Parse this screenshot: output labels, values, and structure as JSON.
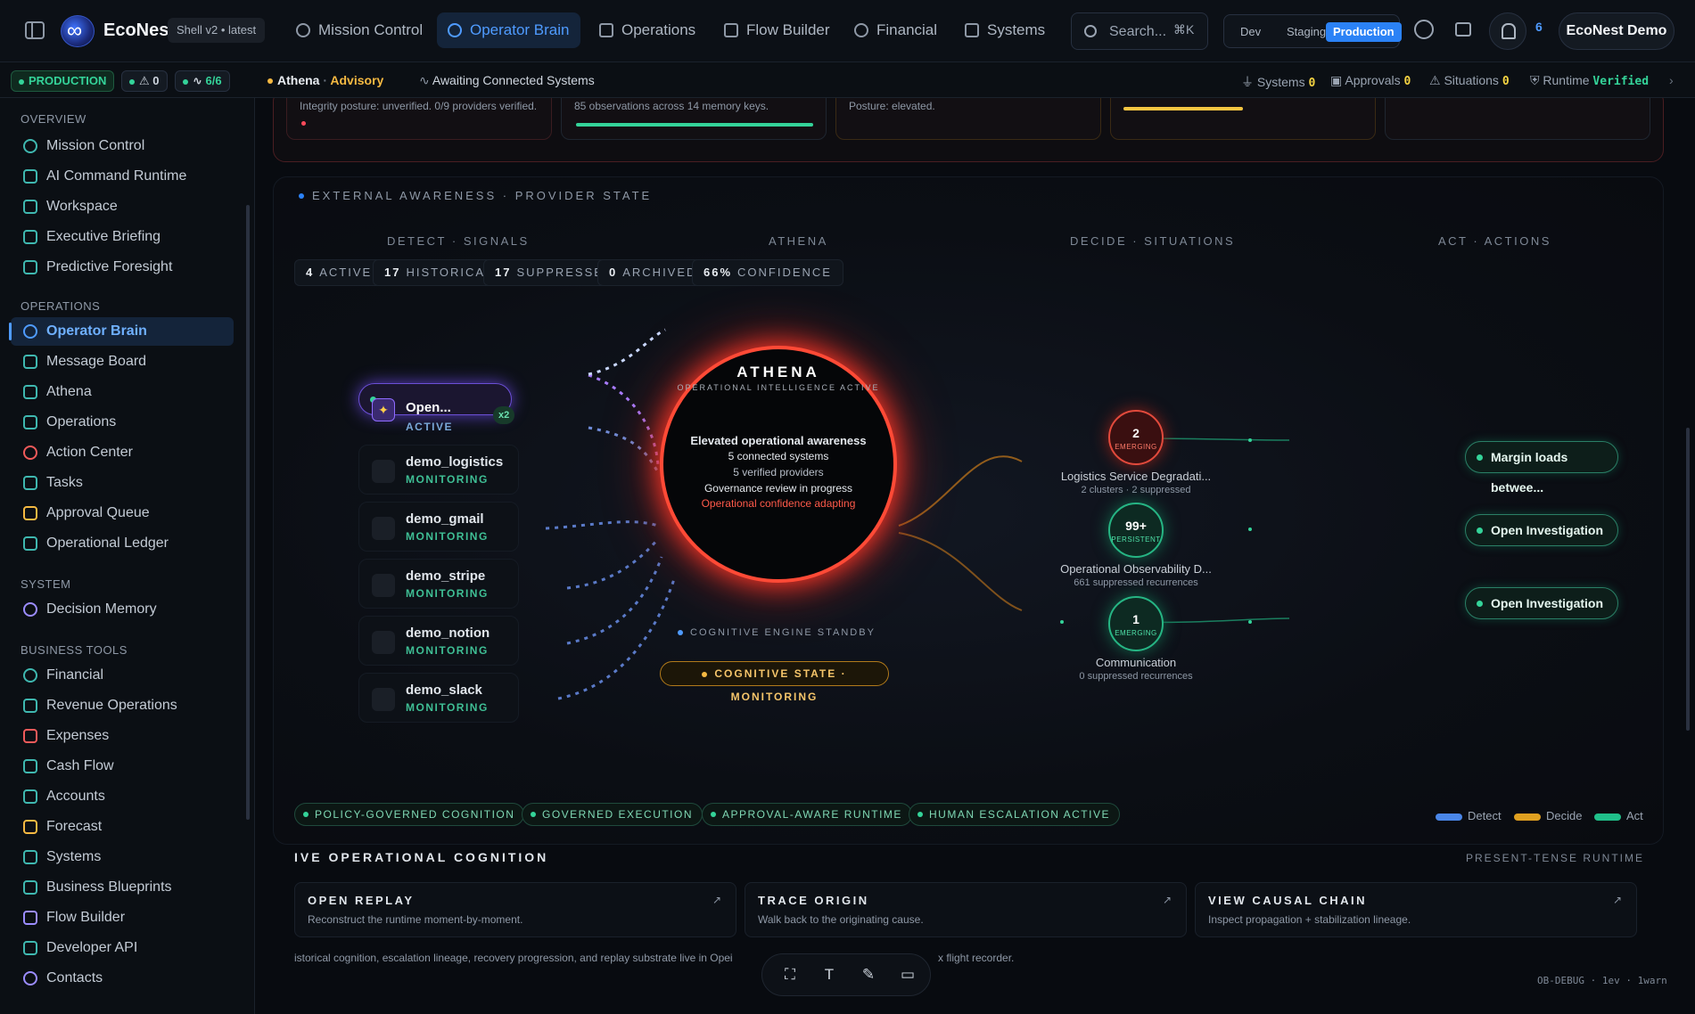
{
  "topbar": {
    "brand": "EcoNest",
    "shell": "Shell v2 • latest",
    "nav": [
      {
        "label": "Mission Control"
      },
      {
        "label": "Operator Brain"
      },
      {
        "label": "Operations"
      },
      {
        "label": "Flow Builder"
      },
      {
        "label": "Financial"
      },
      {
        "label": "Systems"
      }
    ],
    "search_placeholder": "Search...",
    "search_kbd": "⌘K",
    "env": [
      "Dev",
      "Staging",
      "Production"
    ],
    "notif_count": "6",
    "account": "EcoNest Demo"
  },
  "subbar": {
    "env_pill": "PRODUCTION",
    "alerts": "0",
    "health": "6/6",
    "context": "Athena",
    "context_sep": "·",
    "mode": "Advisory",
    "awaiting": "Awaiting Connected Systems",
    "systems_label": "Systems",
    "systems_val": "0",
    "approvals_label": "Approvals",
    "approvals_val": "0",
    "situations_label": "Situations",
    "situations_val": "0",
    "runtime_label": "Runtime",
    "runtime_val": "Verified"
  },
  "sidebar": {
    "overview": "OVERVIEW",
    "operations": "OPERATIONS",
    "system": "SYSTEM",
    "business_tools": "BUSINESS TOOLS",
    "overview_items": [
      "Mission Control",
      "AI Command Runtime",
      "Workspace",
      "Executive Briefing",
      "Predictive Foresight"
    ],
    "operations_items": [
      "Operator Brain",
      "Message Board",
      "Athena",
      "Operations",
      "Action Center",
      "Tasks",
      "Approval Queue",
      "Operational Ledger"
    ],
    "system_items": [
      "Decision Memory"
    ],
    "business_items": [
      "Financial",
      "Revenue Operations",
      "Expenses",
      "Cash Flow",
      "Accounts",
      "Forecast",
      "Systems",
      "Business Blueprints",
      "Flow Builder",
      "Developer API",
      "Contacts"
    ]
  },
  "topcards": [
    "Integrity posture: unverified. 0/9 providers verified.",
    "85 observations across 14 memory keys.",
    "Posture: elevated.",
    "",
    ""
  ],
  "panel": {
    "title": "EXTERNAL AWARENESS · PROVIDER STATE",
    "cols": [
      "DETECT · SIGNALS",
      "ATHENA",
      "DECIDE · SITUATIONS",
      "ACT · ACTIONS"
    ],
    "stats": [
      {
        "n": "4",
        "l": "ACTIVE"
      },
      {
        "n": "17",
        "l": "HISTORICAL"
      },
      {
        "n": "17",
        "l": "SUPPRESSED"
      },
      {
        "n": "0",
        "l": "ARCHIVED"
      },
      {
        "n": "66%",
        "l": "CONFIDENCE"
      }
    ],
    "providers": [
      {
        "name": "Open...",
        "status": "ACTIVE",
        "badge": "x2"
      },
      {
        "name": "demo_logistics",
        "status": "MONITORING"
      },
      {
        "name": "demo_gmail",
        "status": "MONITORING"
      },
      {
        "name": "demo_stripe",
        "status": "MONITORING"
      },
      {
        "name": "demo_notion",
        "status": "MONITORING"
      },
      {
        "name": "demo_slack",
        "status": "MONITORING"
      }
    ],
    "core": {
      "title": "ATHENA",
      "sub": "OPERATIONAL INTELLIGENCE ACTIVE",
      "l1": "Elevated operational awareness",
      "l2": "5 connected systems",
      "l3": "5 verified providers",
      "l4": "Governance review in progress",
      "l5": "Operational confidence adapting"
    },
    "standby": "COGNITIVE ENGINE STANDBY",
    "cogstate": "COGNITIVE STATE · MONITORING",
    "situations": [
      {
        "count": "2",
        "state": "EMERGING",
        "title": "Logistics Service Degradati...",
        "sub": "2 clusters · 2 suppressed"
      },
      {
        "count": "99+",
        "state": "PERSISTENT",
        "title": "Operational Observability D...",
        "sub": "661 suppressed recurrences"
      },
      {
        "count": "1",
        "state": "EMERGING",
        "title": "Communication",
        "sub": "0 suppressed recurrences"
      }
    ],
    "actions": [
      "Margin loads betwee...",
      "Open Investigation",
      "Open Investigation"
    ],
    "badges": [
      "POLICY-GOVERNED COGNITION",
      "GOVERNED EXECUTION",
      "APPROVAL-AWARE RUNTIME",
      "HUMAN ESCALATION ACTIVE"
    ],
    "legend": [
      {
        "label": "Detect",
        "color": "#4a86e8"
      },
      {
        "label": "Decide",
        "color": "#e0a020"
      },
      {
        "label": "Act",
        "color": "#20c08a"
      }
    ]
  },
  "cognition": {
    "title": "IVE OPERATIONAL COGNITION",
    "right": "PRESENT-TENSE RUNTIME",
    "cards": [
      {
        "t": "OPEN REPLAY",
        "d": "Reconstruct the runtime moment-by-moment."
      },
      {
        "t": "TRACE ORIGIN",
        "d": "Walk back to the originating cause."
      },
      {
        "t": "VIEW CAUSAL CHAIN",
        "d": "Inspect propagation + stabilization lineage."
      }
    ],
    "footnote": "istorical cognition, escalation lineage, recovery progression, and replay substrate live in Opei",
    "footnote2": "x flight recorder.",
    "debug": "OB-DEBUG · 1ev · 1warn"
  }
}
